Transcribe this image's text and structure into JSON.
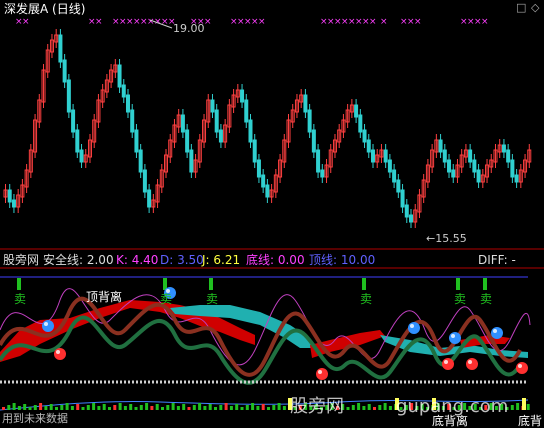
{
  "title": "深发展A (日线)",
  "controls": {
    "collapse": "□",
    "close": "◇"
  },
  "price_panel": {
    "high_label": "19.00",
    "low_label": "←15.55",
    "colors": {
      "up": "#ff4040",
      "down": "#30d0d0",
      "markers": "#ff40ff",
      "frame": "#b00000"
    }
  },
  "indicator_header": {
    "name": "股旁网",
    "safety_label": "安全线: 2.00",
    "k_label": "K: 4.40",
    "d_label": "D: 3.50",
    "j_label": "J: 6.21",
    "bottom_line_label": "底线: 0.00",
    "top_line_label": "顶线: 10.00",
    "diff_label": "DIFF: -",
    "colors": {
      "k": "#ff40ff",
      "d": "#4040ff",
      "j": "#ffff40",
      "bottom": "#ff40ff",
      "top": "#4040ff"
    }
  },
  "annotations": {
    "top_divergence": "顶背离",
    "sell": "卖",
    "bottom_divergence": "底背离",
    "buy_partial": "底背"
  },
  "watermark": {
    "left": "股旁网",
    "right": "gupang.com"
  },
  "footer_text": "用到未来数据",
  "colors": {
    "green_bar": "#20c020",
    "red_band": "#d00000",
    "teal_band": "#20b0b0",
    "dotted": "#c0c0c0"
  }
}
